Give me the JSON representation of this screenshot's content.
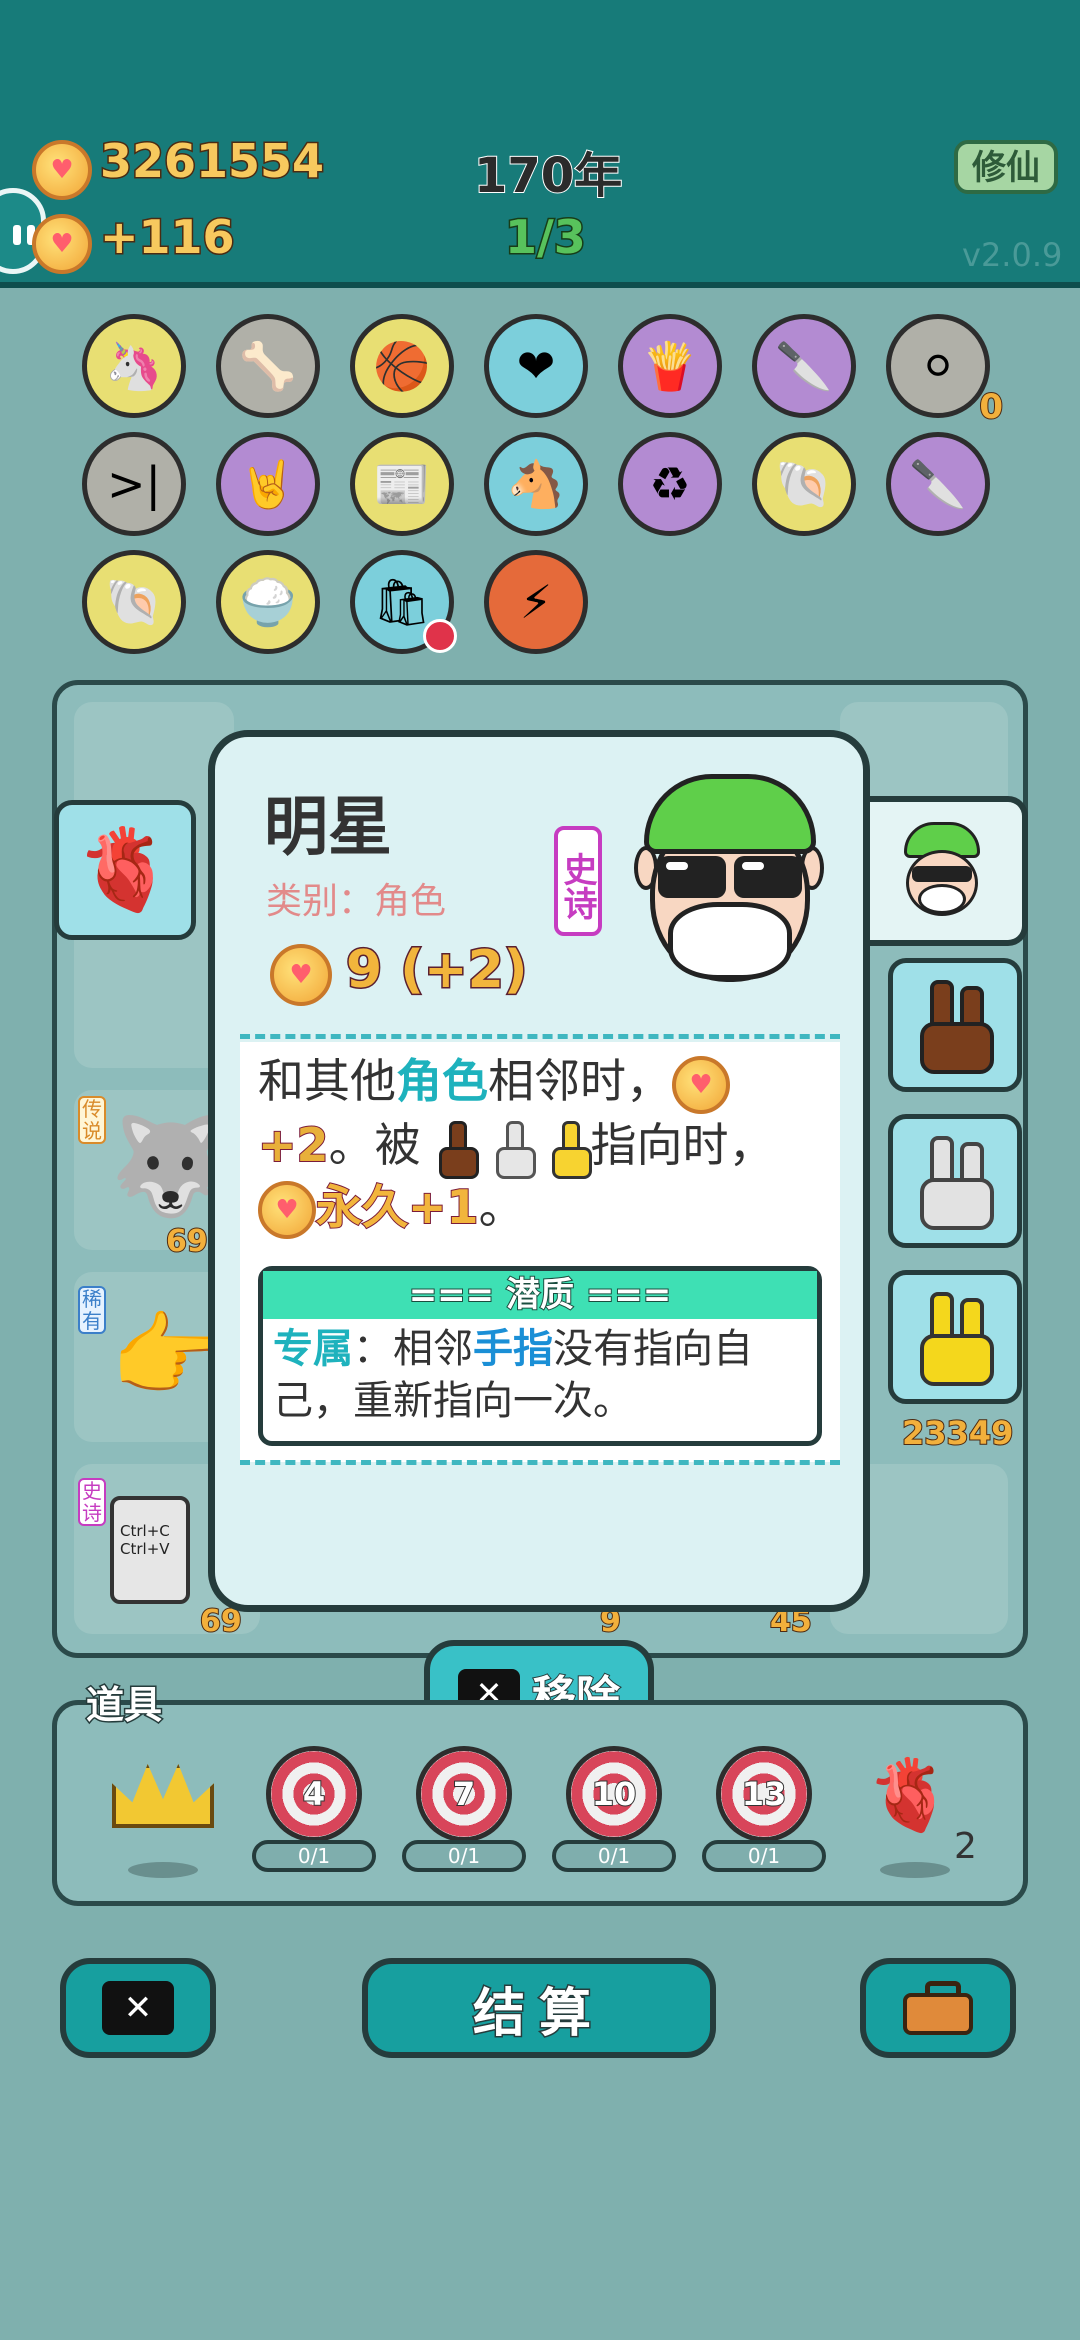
{
  "header": {
    "coins": "3261554",
    "coins_per_turn": "+116",
    "years": "170年",
    "round": "1/3",
    "mode_button": "修仙",
    "version": "v2.0.9"
  },
  "symbols_row1": [
    {
      "icon": "unicorn-icon",
      "glyph": "🦄",
      "bg": "y"
    },
    {
      "icon": "pet-bowl-icon",
      "glyph": "🦴",
      "bg": "g"
    },
    {
      "icon": "basketballs-icon",
      "glyph": "🏀",
      "bg": "y"
    },
    {
      "icon": "blood-bag-icon",
      "glyph": "❤",
      "bg": "b"
    },
    {
      "icon": "fries-icon",
      "glyph": "🍟",
      "bg": "p"
    },
    {
      "icon": "cleaver-icon",
      "glyph": "🔪",
      "bg": "p"
    },
    {
      "icon": "egg-tray-icon",
      "glyph": "⚪",
      "bg": "g",
      "count": "0"
    }
  ],
  "symbols_row2": [
    {
      "icon": "skip-icon",
      "glyph": ">|",
      "bg": "g"
    },
    {
      "icon": "rock-hand-icon",
      "glyph": "🤘",
      "bg": "p"
    },
    {
      "icon": "time-magazine-icon",
      "glyph": "📰",
      "bg": "y"
    },
    {
      "icon": "twin-horses-icon",
      "glyph": "🐴",
      "bg": "b"
    },
    {
      "icon": "recycle-icon",
      "glyph": "♻",
      "bg": "p"
    },
    {
      "icon": "shell-icon",
      "glyph": "🐚",
      "bg": "y"
    },
    {
      "icon": "cleaver-icon",
      "glyph": "🔪",
      "bg": "p"
    }
  ],
  "symbols_row3": [
    {
      "icon": "shell-icon",
      "glyph": "🐚",
      "bg": "y"
    },
    {
      "icon": "rice-bowl-icon",
      "glyph": "🍚",
      "bg": "y"
    },
    {
      "icon": "trash-bag-icon",
      "glyph": "🛍",
      "bg": "b"
    },
    {
      "icon": "lightning-icon",
      "glyph": "⚡",
      "bg": "r"
    }
  ],
  "board": {
    "cell_numbers": [
      "69",
      "69",
      "9",
      "45",
      "23349"
    ],
    "tags": [
      "传说",
      "稀有",
      "史诗"
    ],
    "ctrl_text": "Ctrl+C\nCtrl+V"
  },
  "popup": {
    "name": "明星",
    "category": "类别：角色",
    "rarity": "史诗",
    "value": "9 (+2)",
    "desc_part1": "和其他",
    "desc_role": "角色",
    "desc_part2": "相邻时，",
    "desc_bonus": "+2",
    "desc_part3": "。被",
    "desc_part4": "指向时，",
    "desc_perm": "永久+1",
    "desc_end": "。",
    "quality_title": "=== 潜质 ===",
    "quality_key": "专属",
    "quality_text1": "：相邻",
    "quality_finger": "手指",
    "quality_text2": "没有指向自己，重新指向一次。"
  },
  "remove_button": "移除",
  "items": {
    "title": "道具",
    "targets": [
      {
        "n": "4",
        "progress": "0/1"
      },
      {
        "n": "7",
        "progress": "0/1"
      },
      {
        "n": "10",
        "progress": "0/1"
      },
      {
        "n": "13",
        "progress": "0/1"
      }
    ],
    "liver_count": "2"
  },
  "bottom": {
    "settle_button": "结算"
  },
  "colors": {
    "header": "#177b79",
    "accent_cyan": "#1eb2bd",
    "gold": "#e8b03a"
  }
}
